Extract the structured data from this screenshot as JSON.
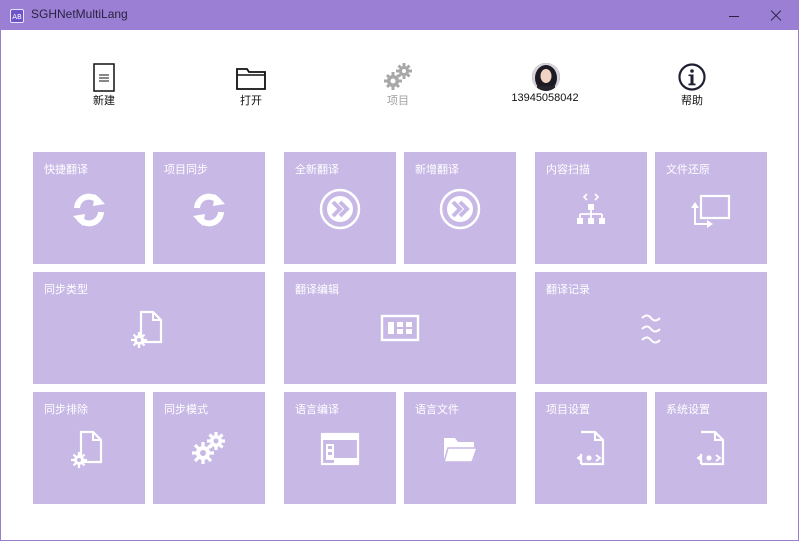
{
  "window": {
    "title": "SGHNetMultiLang",
    "app_icon_text": "AB"
  },
  "toolbar": {
    "new_label": "新建",
    "open_label": "打开",
    "project_label": "项目",
    "user_label": "13945058042",
    "help_label": "帮助"
  },
  "tiles": {
    "quick_translate": "快捷翻译",
    "project_sync": "项目同步",
    "full_translate": "全新翻译",
    "incremental_translate": "新增翻译",
    "content_scan": "内容扫描",
    "file_restore": "文件还原",
    "sync_type": "同步类型",
    "translate_edit": "翻译编辑",
    "translate_log": "翻译记录",
    "sync_exclude": "同步排除",
    "sync_mode": "同步模式",
    "language_compile": "语言编译",
    "language_file": "语言文件",
    "project_settings": "项目设置",
    "system_settings": "系统设置"
  },
  "colors": {
    "accent": "#9b7fd4",
    "tile": "#c7b8e6",
    "icon": "#ffffff"
  }
}
